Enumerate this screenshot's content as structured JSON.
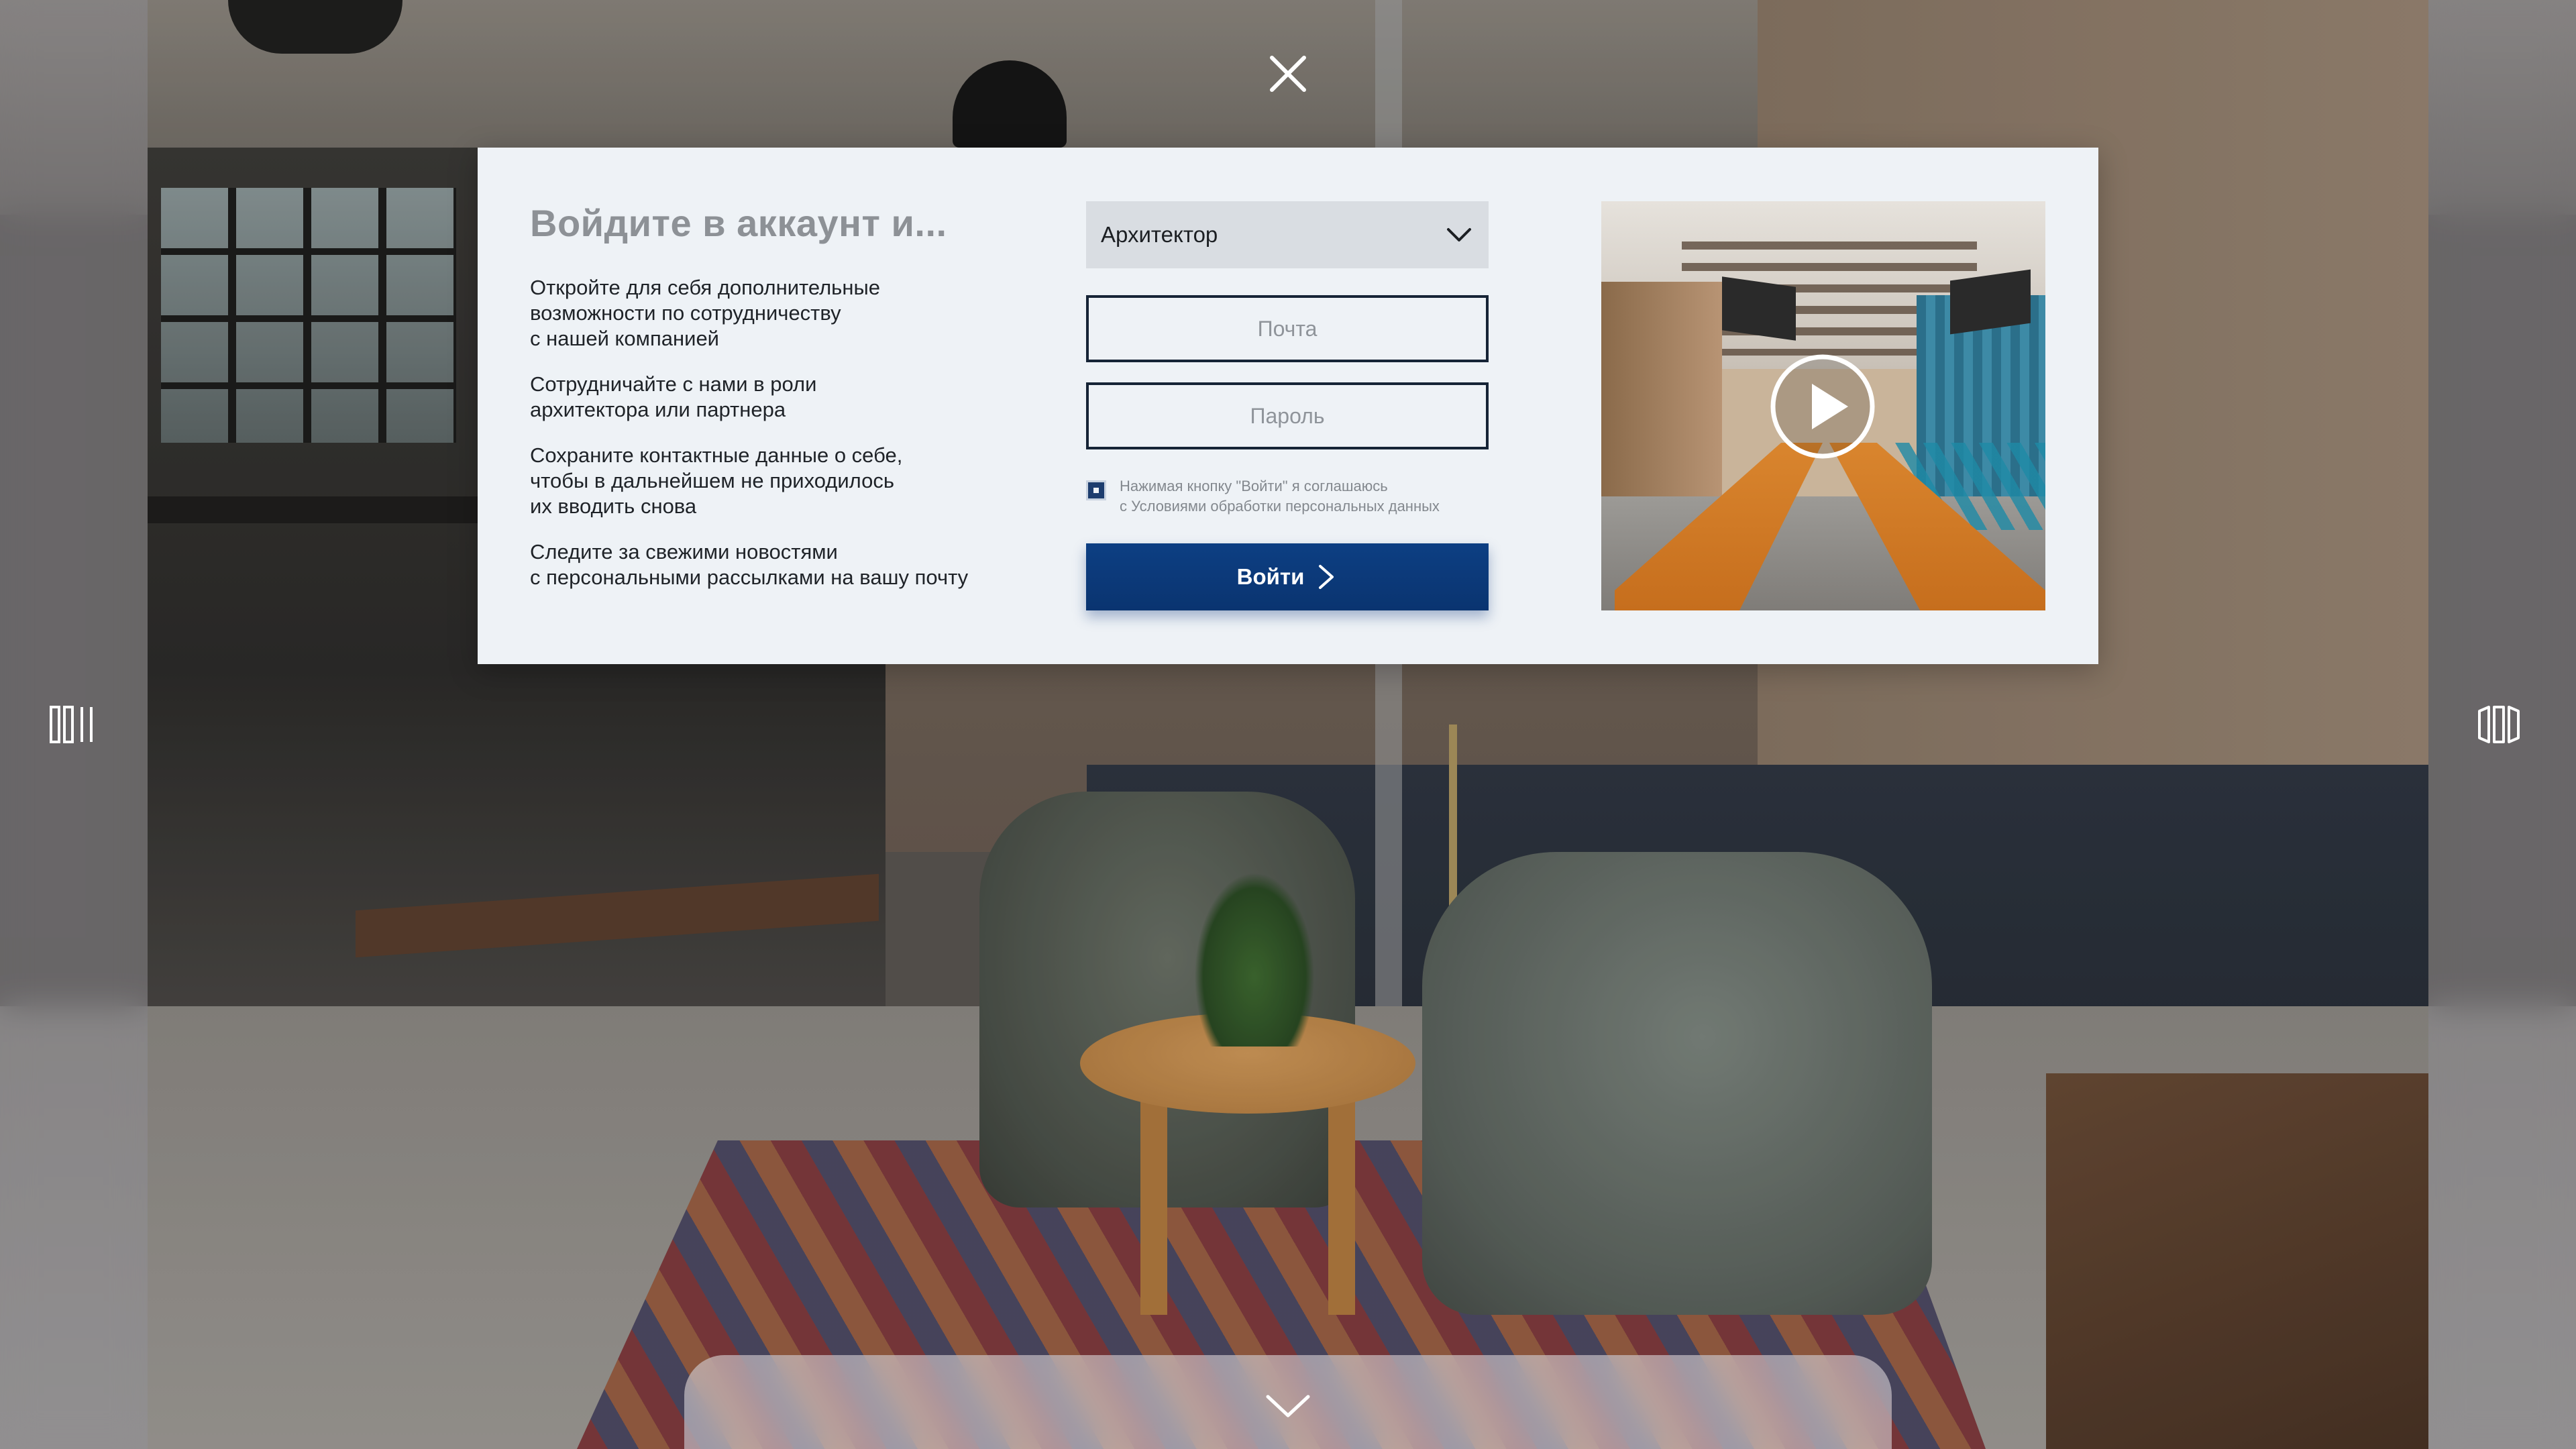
{
  "close_button": {
    "icon": "close-icon"
  },
  "login_modal": {
    "title": "Войдите в аккаунт и...",
    "benefits": [
      "Откройте для себя дополнительные\nвозможности по сотрудничеству\nс нашей компанией",
      "Сотрудничайте с нами в роли\nархитектора или партнера",
      "Сохраните контактные данные о себе,\nчтобы в дальнейшем не приходилось\nих вводить снова",
      "Следите за свежими новостями\nс персональными рассылками на вашу почту"
    ],
    "role_select": {
      "value": "Архитектор",
      "icon": "chevron-down-icon"
    },
    "email_field": {
      "placeholder": "Почта",
      "value": ""
    },
    "password_field": {
      "placeholder": "Пароль",
      "value": ""
    },
    "consent": {
      "checked": true,
      "text": "Нажимая кнопку \"Войти\" я соглашаюсь\nс Условиями обработки персональных данных"
    },
    "login_button": {
      "label": "Войти",
      "icon": "chevron-right-icon"
    },
    "video": {
      "icon": "play-icon"
    }
  },
  "side_nav": {
    "left_icon": "panels-left-icon",
    "right_icon": "panels-right-icon"
  },
  "bottom_drawer": {
    "icon": "chevron-down-icon"
  },
  "colors": {
    "primary": "#0b3a7c",
    "modal_background": "#eef2f6",
    "field_border": "#162436",
    "select_background": "#d9dde2",
    "title": "#8d9196",
    "text": "#1f2328"
  }
}
